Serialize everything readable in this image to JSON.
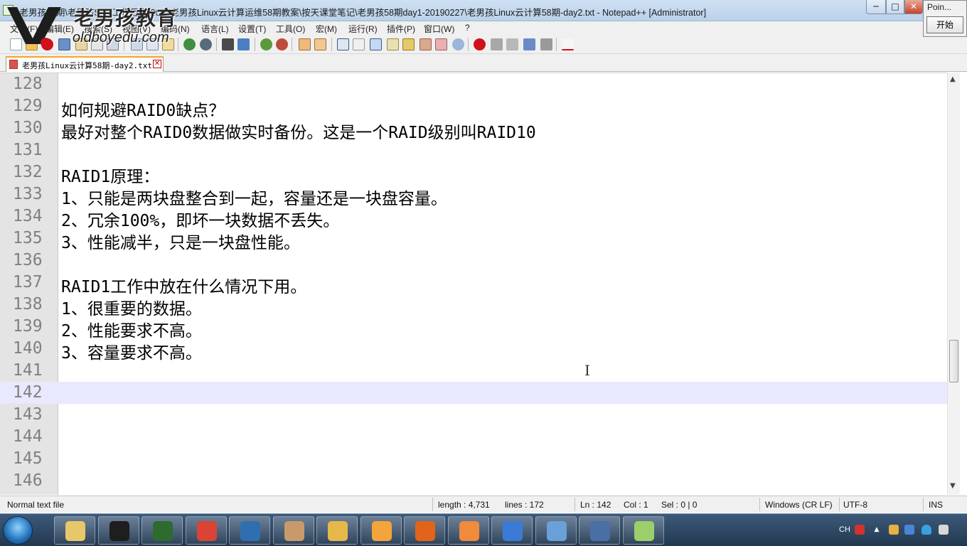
{
  "window": {
    "title": "\\老男孩58期\\老男孩SVN工作目录\\2019老男孩Linux云计算运维58期教案\\按天课堂笔记\\老男孩58期day1-20190227\\老男孩Linux云计算58期-day2.txt - Notepad++ [Administrator]",
    "minimize_label": "─",
    "maximize_label": "□",
    "close_label": "✕"
  },
  "watermark": {
    "brand": "老男孩教育",
    "url": "oldboyedu.com"
  },
  "point_window": {
    "title": "Poin...",
    "start_button": "开始"
  },
  "menu": [
    "文件(F)",
    "编辑(E)",
    "搜索(S)",
    "视图(V)",
    "编码(N)",
    "语言(L)",
    "设置(T)",
    "工具(O)",
    "宏(M)",
    "运行(R)",
    "插件(P)",
    "窗口(W)",
    "?"
  ],
  "tab": {
    "label": "老男孩Linux云计算58期-day2.txt",
    "close": "✕"
  },
  "editor": {
    "current_line": 142,
    "lines": [
      {
        "num": "128",
        "text": ""
      },
      {
        "num": "129",
        "text": "如何规避RAID0缺点？"
      },
      {
        "num": "130",
        "text": "最好对整个RAID0数据做实时备份。这是一个RAID级别叫RAID10"
      },
      {
        "num": "131",
        "text": ""
      },
      {
        "num": "132",
        "text": "RAID1原理："
      },
      {
        "num": "133",
        "text": "1、只能是两块盘整合到一起，容量还是一块盘容量。"
      },
      {
        "num": "134",
        "text": "2、冗余100%，即坏一块数据不丢失。"
      },
      {
        "num": "135",
        "text": "3、性能减半，只是一块盘性能。"
      },
      {
        "num": "136",
        "text": ""
      },
      {
        "num": "137",
        "text": "RAID1工作中放在什么情况下用。"
      },
      {
        "num": "138",
        "text": "1、很重要的数据。"
      },
      {
        "num": "139",
        "text": "2、性能要求不高。"
      },
      {
        "num": "140",
        "text": "3、容量要求不高。"
      },
      {
        "num": "141",
        "text": ""
      },
      {
        "num": "142",
        "text": ""
      },
      {
        "num": "143",
        "text": ""
      },
      {
        "num": "144",
        "text": ""
      },
      {
        "num": "145",
        "text": ""
      },
      {
        "num": "146",
        "text": ""
      }
    ],
    "scroll_position": 0.72
  },
  "status": {
    "file_type": "Normal text file",
    "length": "length : 4,731",
    "lines": "lines : 172",
    "ln": "Ln : 142",
    "col": "Col : 1",
    "sel": "Sel : 0 | 0",
    "eol": "Windows (CR LF)",
    "encoding": "UTF-8",
    "mode": "INS"
  },
  "taskbar": {
    "apps": [
      {
        "name": "file-explorer-icon",
        "color": "#e8c76a"
      },
      {
        "name": "pycharm-icon",
        "color": "#1e1e1e"
      },
      {
        "name": "terminal-icon",
        "color": "#2e6b2e"
      },
      {
        "name": "chrome-icon",
        "color": "#d94436"
      },
      {
        "name": "virtualbox-icon",
        "color": "#2f6fb0"
      },
      {
        "name": "avatar-app-icon",
        "color": "#c89a6a"
      },
      {
        "name": "paint-icon",
        "color": "#e6b84a"
      },
      {
        "name": "qq-icon",
        "color": "#f3a43a"
      },
      {
        "name": "firefox-icon",
        "color": "#e2641b"
      },
      {
        "name": "slides-icon",
        "color": "#f08a3c"
      },
      {
        "name": "wps-icon",
        "color": "#3b7bd6"
      },
      {
        "name": "remote-desktop-icon",
        "color": "#6aa0d8"
      },
      {
        "name": "network-icon",
        "color": "#4a6fa5"
      },
      {
        "name": "notepadpp-icon",
        "color": "#9ccf6a"
      }
    ],
    "tray_lang": "CH"
  },
  "colors": {
    "gutter_bg": "#e4e4e4",
    "current_line_bg": "#e8e8ff",
    "tab_accent": "#f5a623"
  }
}
